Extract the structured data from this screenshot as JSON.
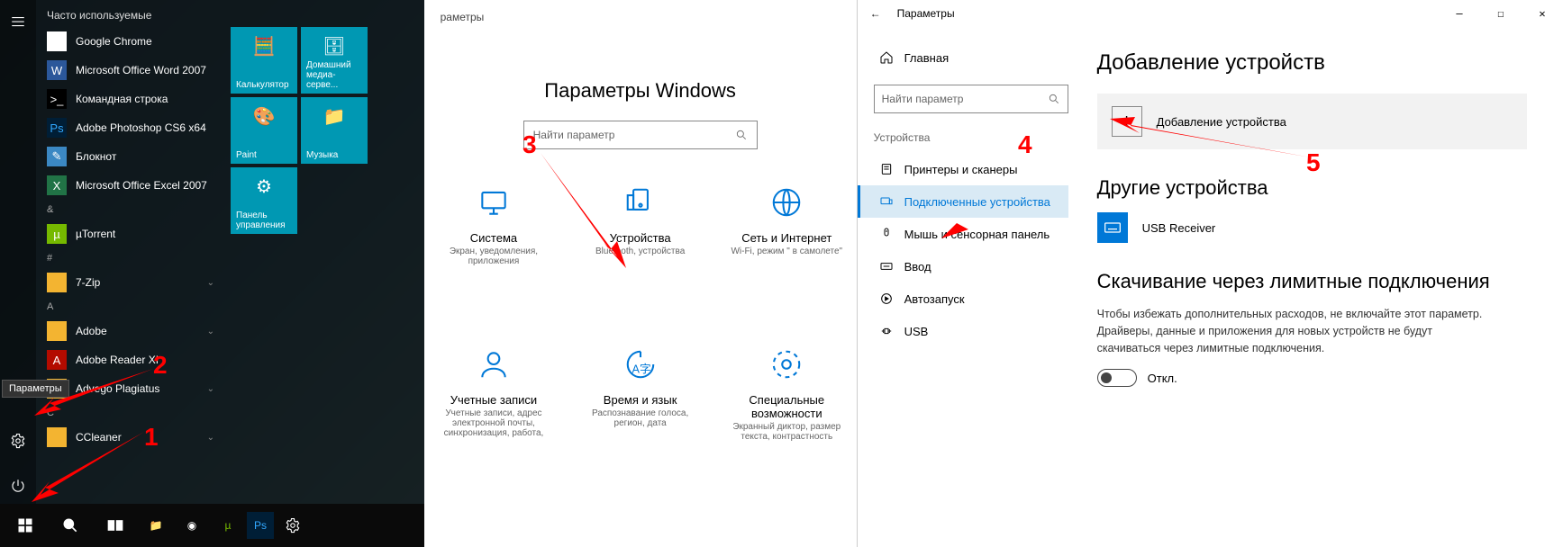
{
  "start": {
    "header": "Часто используемые",
    "apps_most_used": [
      {
        "name": "Google Chrome",
        "cls": "ic-chrome",
        "glyph": "◉"
      },
      {
        "name": "Microsoft Office Word 2007",
        "cls": "ic-word",
        "glyph": "W"
      },
      {
        "name": "Командная строка",
        "cls": "ic-cmd",
        "glyph": ">_"
      },
      {
        "name": "Adobe Photoshop CS6 x64",
        "cls": "ic-ps",
        "glyph": "Ps"
      },
      {
        "name": "Блокнот",
        "cls": "ic-note",
        "glyph": "✎"
      },
      {
        "name": "Microsoft Office Excel 2007",
        "cls": "ic-xl",
        "glyph": "X"
      }
    ],
    "groups": [
      {
        "letter": "&",
        "items": [
          {
            "name": "µTorrent",
            "cls": "ic-ut",
            "glyph": "µ"
          }
        ]
      },
      {
        "letter": "#",
        "items": [
          {
            "name": "7-Zip",
            "cls": "folder",
            "glyph": "",
            "expand": true
          }
        ]
      },
      {
        "letter": "A",
        "items": [
          {
            "name": "Adobe",
            "cls": "folder",
            "glyph": "",
            "expand": true
          },
          {
            "name": "Adobe Reader XI",
            "cls": "ic-pdf",
            "glyph": "A"
          },
          {
            "name": "Advego Plagiatus",
            "cls": "folder",
            "glyph": "",
            "expand": true
          }
        ]
      },
      {
        "letter": "C",
        "items": [
          {
            "name": "CCleaner",
            "cls": "folder",
            "glyph": "",
            "expand": true
          }
        ]
      }
    ],
    "tiles": [
      {
        "label": "Калькулятор",
        "glyph": "🧮"
      },
      {
        "label": "Домашний медиа-серве...",
        "glyph": "🗄"
      },
      {
        "label": "Paint",
        "glyph": "🎨"
      },
      {
        "label": "Музыка",
        "glyph": "📁",
        "wide": false
      },
      {
        "label": "Панель управления",
        "glyph": "⚙",
        "wide": false
      }
    ],
    "tooltip": "Параметры"
  },
  "settings_home": {
    "back_hint": "раметры",
    "title": "Параметры Windows",
    "search_placeholder": "Найти параметр",
    "categories": [
      {
        "name": "Система",
        "desc": "Экран, уведомления, приложения"
      },
      {
        "name": "Устройства",
        "desc": "Bluetooth, устройства"
      },
      {
        "name": "Сеть и Интернет",
        "desc": "Wi-Fi, режим \" в самолете\""
      },
      {
        "name": "Учетные записи",
        "desc": "Учетные записи, адрес электронной почты, синхронизация, работа,"
      },
      {
        "name": "Время и язык",
        "desc": "Распознавание голоса, регион, дата"
      },
      {
        "name": "Специальные возможности",
        "desc": "Экранный диктор, размер текста, контрастность"
      }
    ]
  },
  "devices": {
    "window_title": "Параметры",
    "home": "Главная",
    "search_placeholder": "Найти параметр",
    "group": "Устройства",
    "nav": [
      {
        "name": "Принтеры и сканеры"
      },
      {
        "name": "Подключенные устройства",
        "active": true
      },
      {
        "name": "Мышь и сенсорная панель"
      },
      {
        "name": "Ввод"
      },
      {
        "name": "Автозапуск"
      },
      {
        "name": "USB"
      }
    ],
    "content": {
      "h1": "Добавление устройств",
      "add_label": "Добавление устройства",
      "other_h": "Другие устройства",
      "device": "USB Receiver",
      "meter_h": "Скачивание через лимитные подключения",
      "meter_p": "Чтобы избежать дополнительных расходов, не включайте этот параметр. Драйверы, данные и приложения для новых устройств не будут скачиваться через лимитные подключения.",
      "toggle": "Откл."
    }
  },
  "annotations": {
    "n1": "1",
    "n2": "2",
    "n3": "3",
    "n4": "4",
    "n5": "5"
  }
}
